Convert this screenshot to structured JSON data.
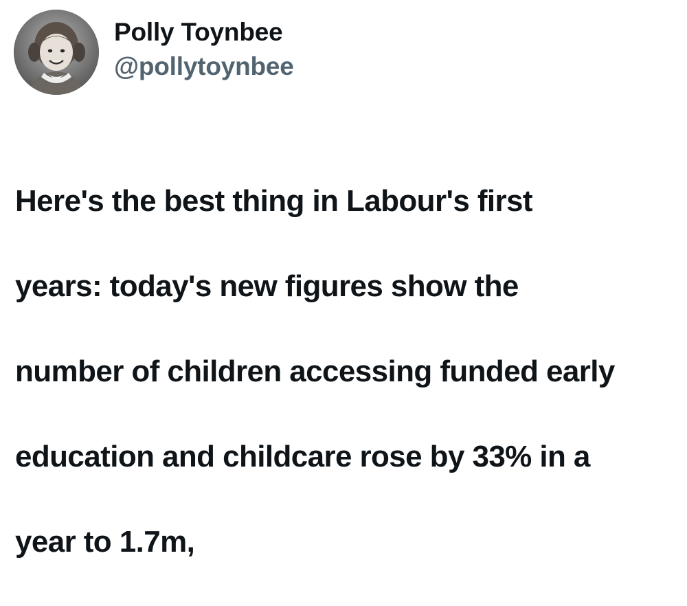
{
  "author": {
    "display_name": "Polly Toynbee",
    "handle": "@pollytoynbee",
    "avatar_icon": "profile-photo-child-black-and-white"
  },
  "tweet": {
    "lines": [
      "Here's the best thing in Labour's first",
      "years: today's new figures show the",
      "number of children accessing funded early",
      "education and childcare rose by 33% in a",
      "year to 1.7m,"
    ]
  },
  "colors": {
    "text_primary": "#0f1419",
    "text_secondary": "#536471",
    "background": "#ffffff"
  }
}
